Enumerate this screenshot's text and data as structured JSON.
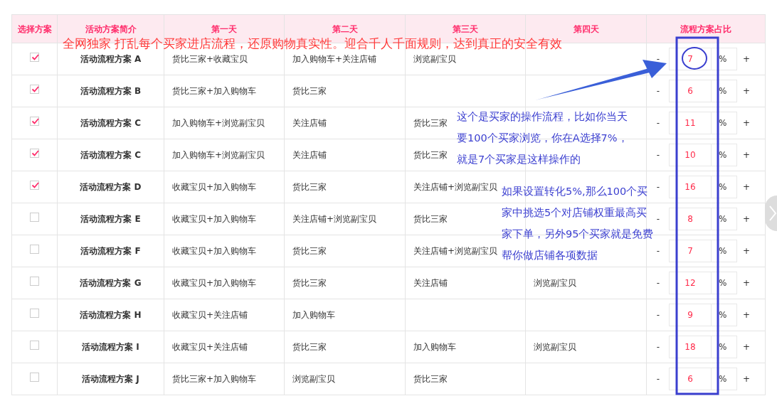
{
  "table": {
    "columns": [
      "选择方案",
      "活动方案简介",
      "第一天",
      "第二天",
      "第三天",
      "第四天",
      "流程方案占比"
    ],
    "rows": [
      {
        "checked": true,
        "plan": "活动流程方案 A",
        "day_1": "货比三家+收藏宝贝",
        "day_2": "加入购物车+关注店铺",
        "day_3": "浏览副宝贝",
        "minus": "-",
        "share": "7",
        "unit": "%",
        "plus": "+"
      },
      {
        "checked": true,
        "plan": "活动流程方案 B",
        "day_1": "货比三家+加入购物车",
        "day_2": "货比三家",
        "minus": "-",
        "share": "6",
        "unit": "%",
        "plus": "+"
      },
      {
        "checked": true,
        "plan": "活动流程方案 C",
        "day_1": "加入购物车+浏览副宝贝",
        "day_2": "关注店铺",
        "day_3": "货比三家",
        "minus": "-",
        "share": "11",
        "unit": "%",
        "plus": "+"
      },
      {
        "checked": true,
        "plan": "活动流程方案 C",
        "day_1": "加入购物车+浏览副宝贝",
        "day_2": "关注店铺",
        "day_3": "货比三家",
        "minus": "-",
        "share": "10",
        "unit": "%",
        "plus": "+"
      },
      {
        "checked": true,
        "plan": "活动流程方案 D",
        "day_1": "收藏宝贝+加入购物车",
        "day_2": "货比三家",
        "day_3": "关注店铺+浏览副宝贝",
        "minus": "-",
        "share": "16",
        "unit": "%",
        "plus": "+"
      },
      {
        "checked": false,
        "plan": "活动流程方案 E",
        "day_1": "收藏宝贝+加入购物车",
        "day_2": "关注店铺+浏览副宝贝",
        "day_3": "货比三家",
        "minus": "-",
        "share": "8",
        "unit": "%",
        "plus": "+"
      },
      {
        "checked": false,
        "plan": "活动流程方案 F",
        "day_1": "收藏宝贝+加入购物车",
        "day_2": "货比三家",
        "day_3": "关注店铺+浏览副宝贝",
        "minus": "-",
        "share": "7",
        "unit": "%",
        "plus": "+"
      },
      {
        "checked": false,
        "plan": "活动流程方案 G",
        "day_1": "收藏宝贝+加入购物车",
        "day_2": "货比三家",
        "day_3": "关注店铺",
        "day_4": "浏览副宝贝",
        "minus": "-",
        "share": "12",
        "unit": "%",
        "plus": "+"
      },
      {
        "checked": false,
        "plan": "活动流程方案 H",
        "day_1": "收藏宝贝+关注店铺",
        "day_2": "加入购物车",
        "minus": "-",
        "share": "9",
        "unit": "%",
        "plus": "+"
      },
      {
        "checked": false,
        "plan": "活动流程方案 I",
        "day_1": "收藏宝贝+关注店铺",
        "day_2": "货比三家",
        "day_3": "加入购物车",
        "day_4": "浏览副宝贝",
        "minus": "-",
        "share": "18",
        "unit": "%",
        "plus": "+"
      },
      {
        "checked": false,
        "plan": "活动流程方案 J",
        "day_1": "货比三家+加入购物车",
        "day_2": "浏览副宝贝",
        "day_3": "货比三家",
        "minus": "-",
        "share": "6",
        "unit": "%",
        "plus": "+"
      }
    ]
  },
  "annotations": {
    "banner": "全网独家 打乱每个买家进店流程，还原购物真实性。迎合千人千面规则，达到真正的安全有效",
    "notes": [
      {
        "lines": [
          "这个是买家的操作流程，比如你当天",
          "要100个买家浏览，你在A选择7%，",
          "就是7个买家是这样操作的"
        ]
      },
      {
        "lines": [
          "如果设置转化5%,那么100个买",
          "家中挑选5个对店铺权重最高买",
          "家下单，另外95个买家就是免费",
          "帮你做店铺各项数据"
        ]
      }
    ]
  }
}
